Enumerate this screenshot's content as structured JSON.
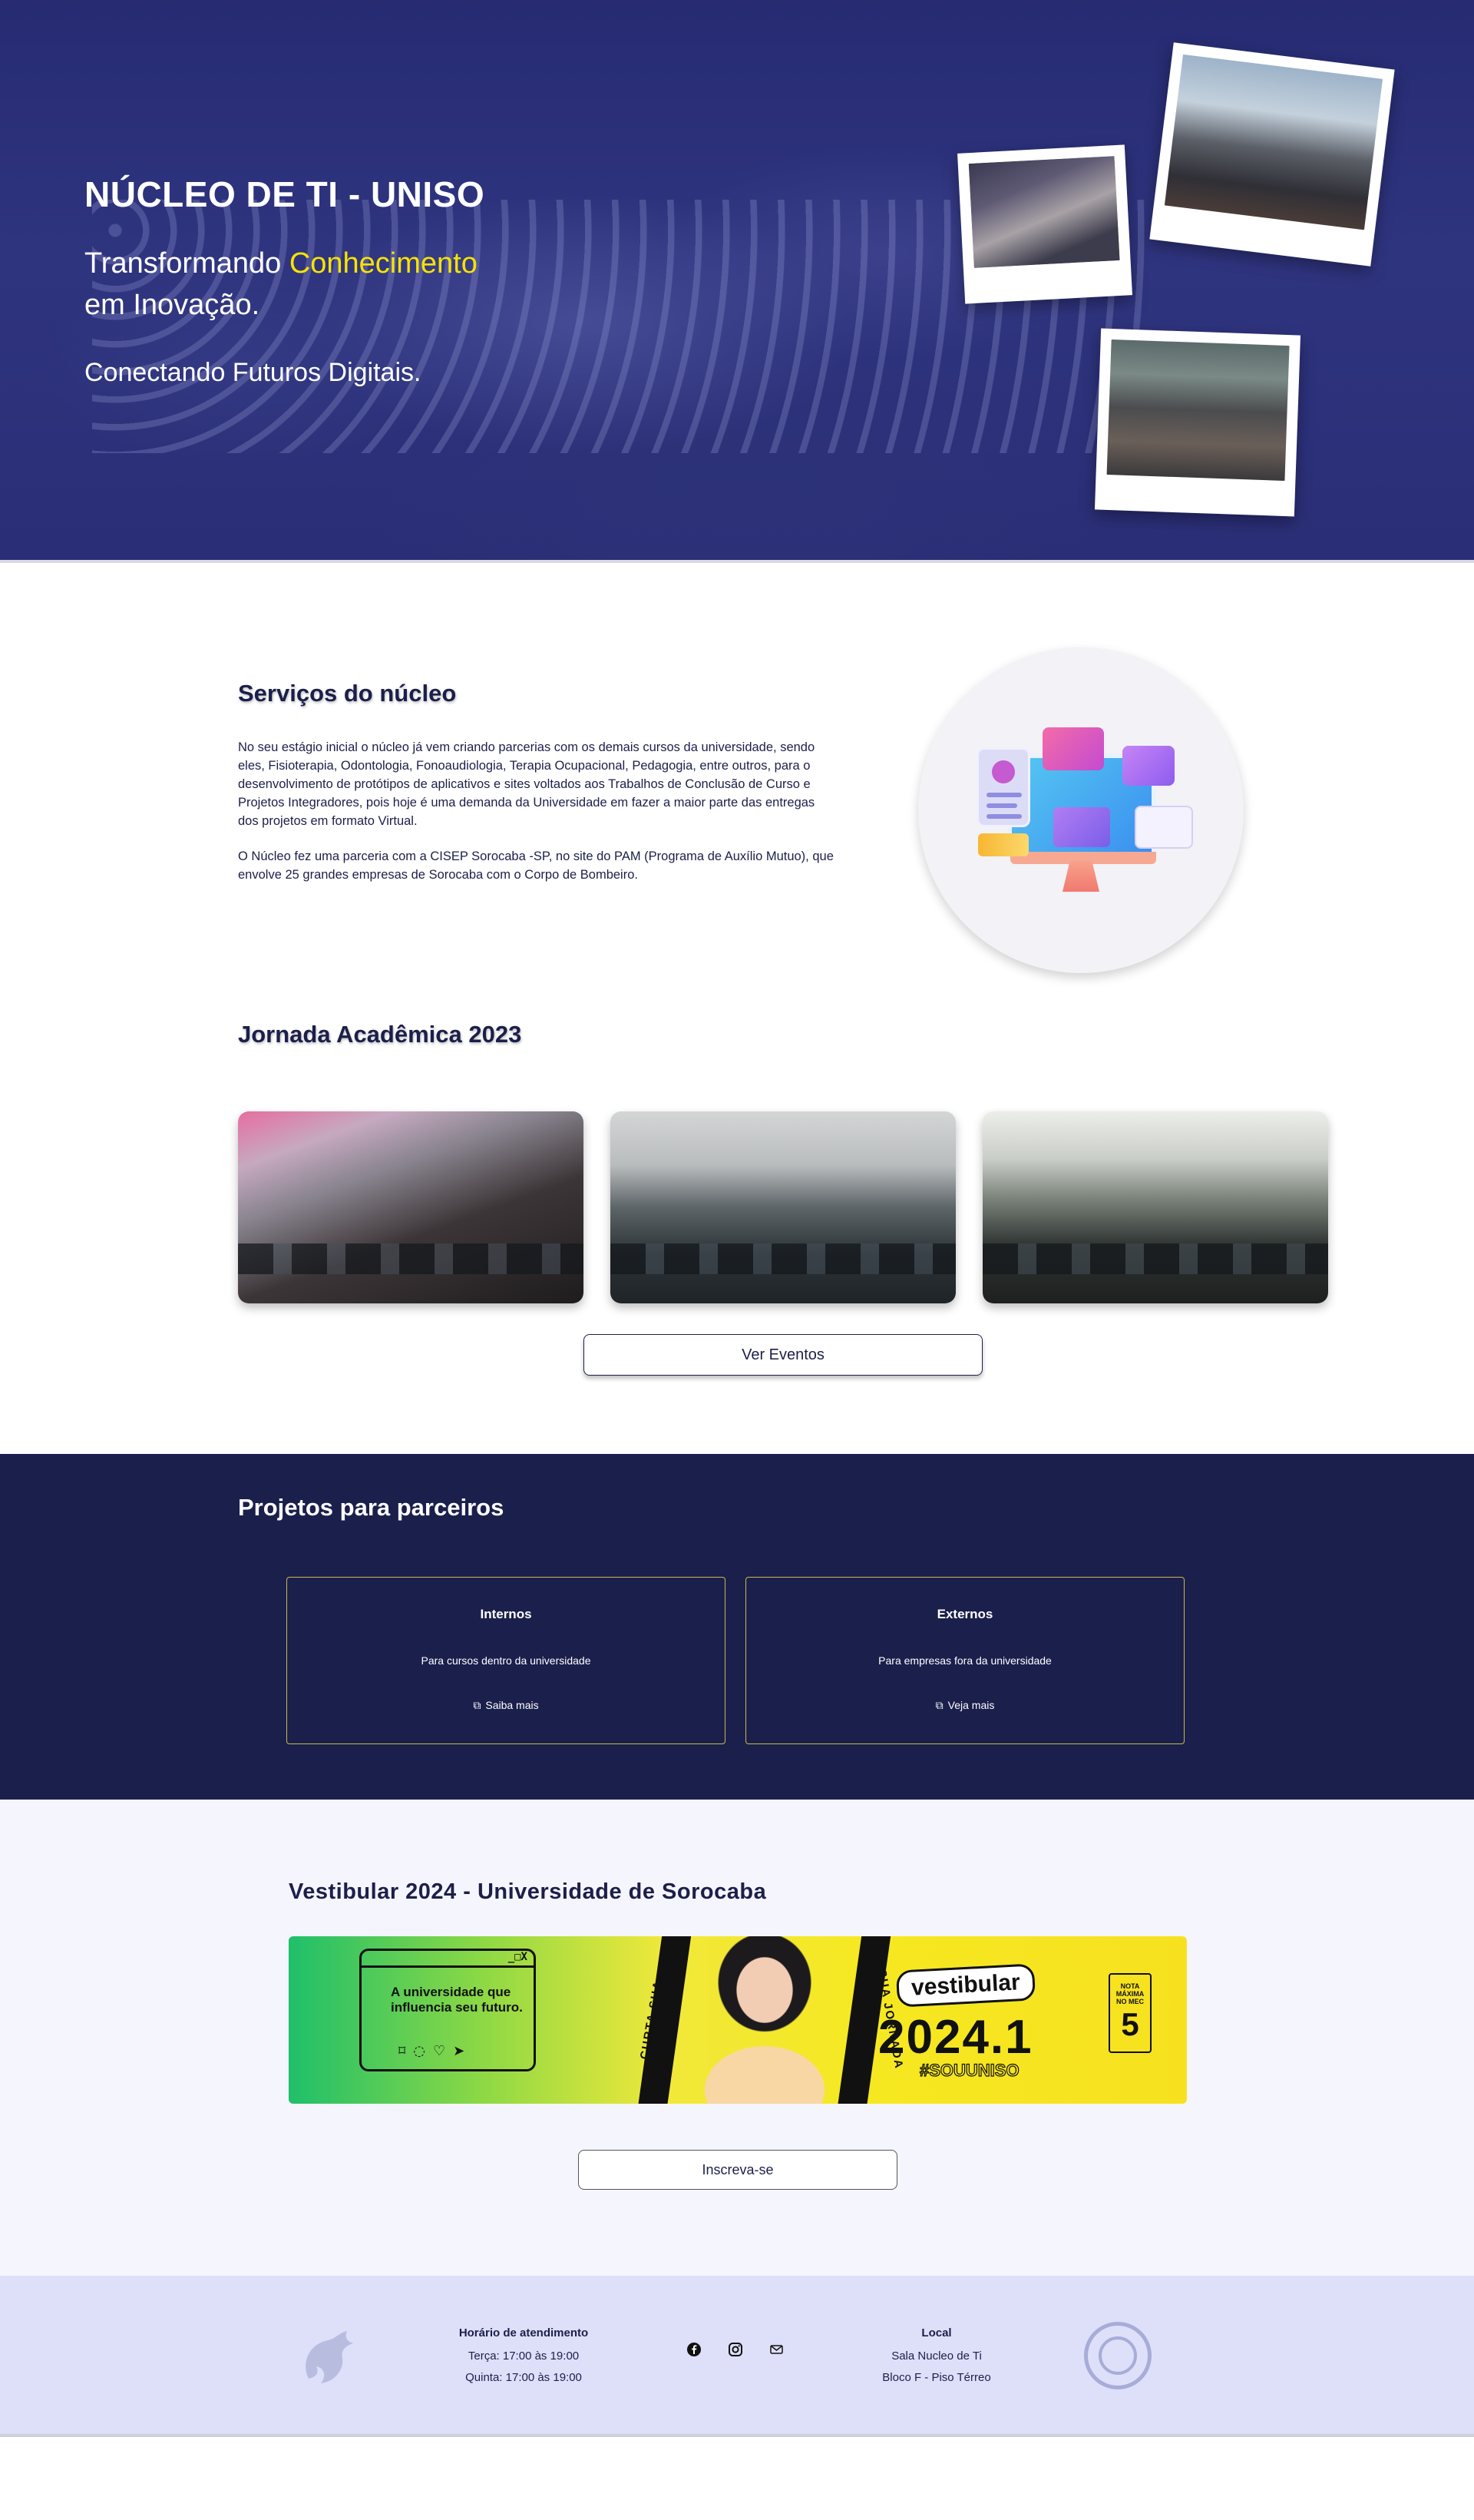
{
  "hero": {
    "title": "NÚCLEO DE TI - UNISO",
    "tagline_pre": "Transformando ",
    "tagline_highlight": "Conhecimento",
    "tagline_post": "em Inovação.",
    "subtagline": "Conectando Futuros Digitais."
  },
  "services": {
    "title": "Serviços do núcleo",
    "paragraph1": "No seu estágio inicial o núcleo já vem criando parcerias com os demais cursos da universidade, sendo eles, Fisioterapia, Odontologia, Fonoaudiologia, Terapia Ocupacional, Pedagogia, entre outros, para o desenvolvimento de protótipos de aplicativos e sites voltados aos Trabalhos de Conclusão de Curso e Projetos Integradores, pois hoje é uma demanda da Universidade em fazer a maior parte das entregas dos projetos em formato Virtual.",
    "paragraph2": "O Núcleo fez uma parceria com a CISEP Sorocaba -SP, no site do PAM (Programa de Auxílio Mutuo), que envolve 25 grandes empresas de Sorocaba com o Corpo de Bombeiro."
  },
  "jornada": {
    "title": "Jornada Acadêmica 2023",
    "button": "Ver Eventos"
  },
  "projetos": {
    "title": "Projetos para parceiros",
    "cards": [
      {
        "title": "Internos",
        "description": "Para cursos dentro da universidade",
        "link": "Saiba mais"
      },
      {
        "title": "Externos",
        "description": "Para empresas fora da universidade",
        "link": "Veja mais"
      }
    ]
  },
  "vestibular": {
    "title": "Vestibular 2024 - Universidade de Sorocaba",
    "banner": {
      "window_controls": "_□X",
      "message": "A universidade que influencia seu futuro.",
      "side_left": "CURTA SUA",
      "side_right": "SUA JORNADA",
      "badge": "vestibular",
      "year": "2024.1",
      "hashtag": "#SOUUNISO",
      "nota_label": "NOTA MÁXIMA NO MEC",
      "nota_value": "5"
    },
    "button": "Inscreva-se"
  },
  "footer": {
    "hours_title": "Horário de atendimento",
    "hours": [
      "Terça: 17:00 às 19:00",
      "Quinta: 17:00 às 19:00"
    ],
    "local_title": "Local",
    "local": [
      "Sala Nucleo de Ti",
      "Bloco F - Piso Térreo"
    ]
  },
  "colors": {
    "primary": "#1c1f4a",
    "hero_bg": "#2b2f79",
    "highlight": "#f7e300",
    "card_border": "#cbb94a",
    "footer_bg": "#dedff9"
  }
}
